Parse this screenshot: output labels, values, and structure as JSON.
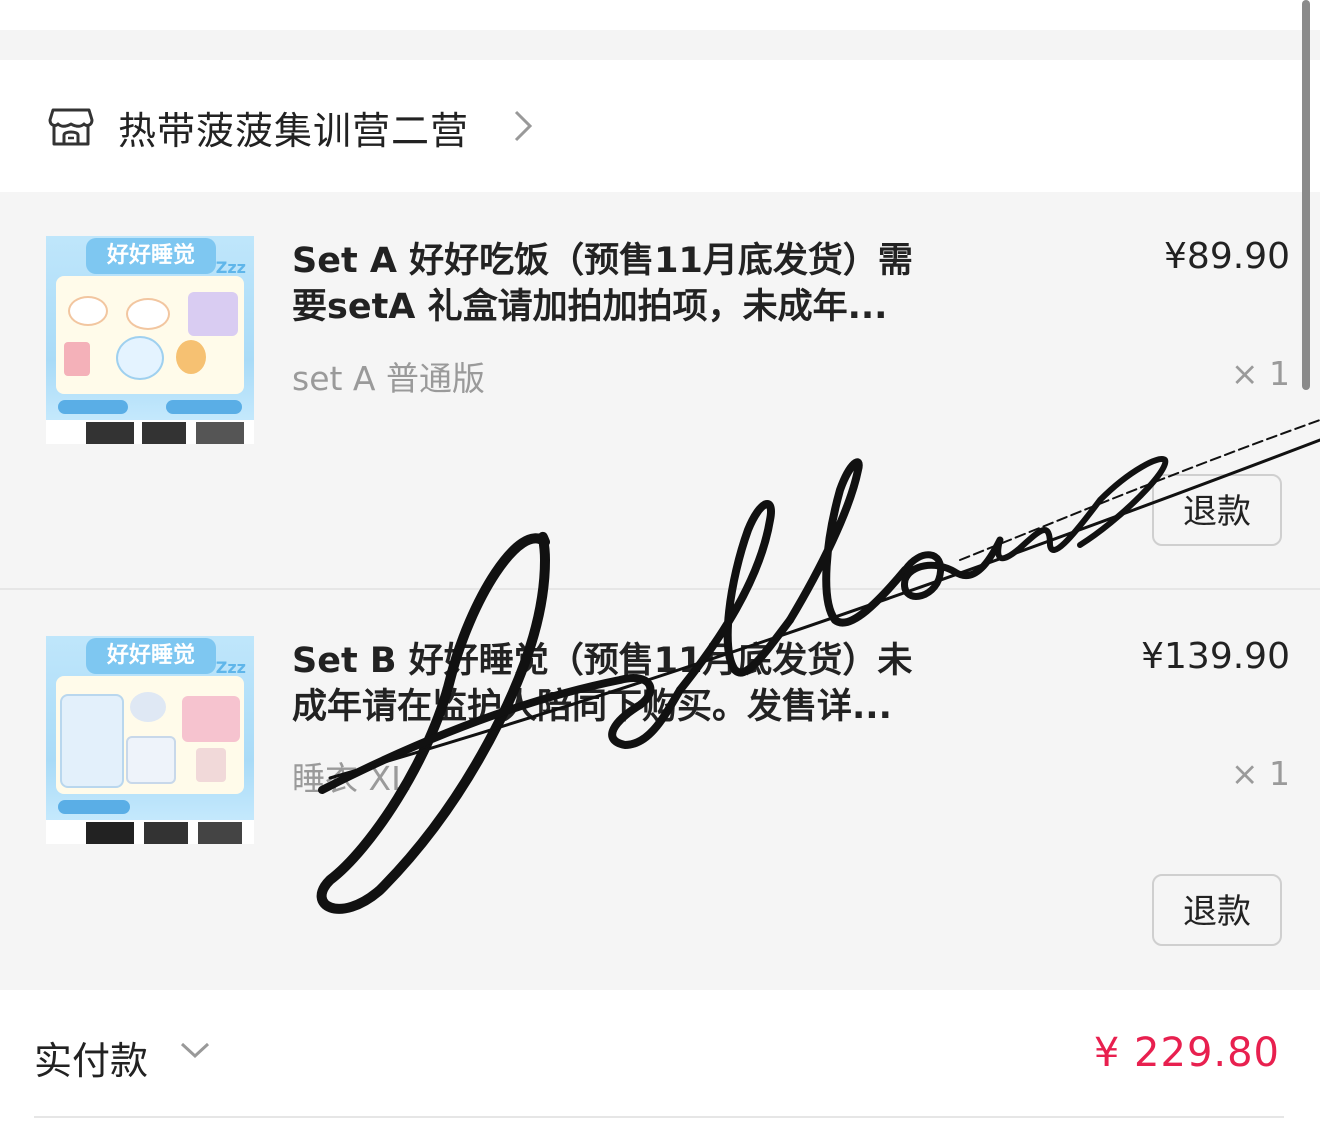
{
  "shop": {
    "name": "热带菠菠集训营二营",
    "icon": "store-icon"
  },
  "items": [
    {
      "image_banner": "好好睡觉",
      "image_zzz": "Zzz",
      "title_line1": "Set A 好好吃饭（预售11月底发货）需",
      "title_line2": "要setA 礼盒请加拍加拍项，未成年...",
      "variant": "set A 普通版",
      "price": "¥89.90",
      "quantity": "× 1",
      "refund_label": "退款"
    },
    {
      "image_banner": "好好睡觉",
      "image_zzz": "Zzz",
      "title_line1": "Set B 好好睡觉（预售11月底发货）未",
      "title_line2": "成年请在监护人陪同下购买。发售详...",
      "variant": "睡衣 XL",
      "price": "¥139.90",
      "quantity": "× 1",
      "refund_label": "退款"
    }
  ],
  "footer": {
    "paid_label": "实付款",
    "paid_amount": "¥ 229.80"
  },
  "colors": {
    "accent_price": "#e8204f",
    "item_background": "#f5f5f5"
  }
}
